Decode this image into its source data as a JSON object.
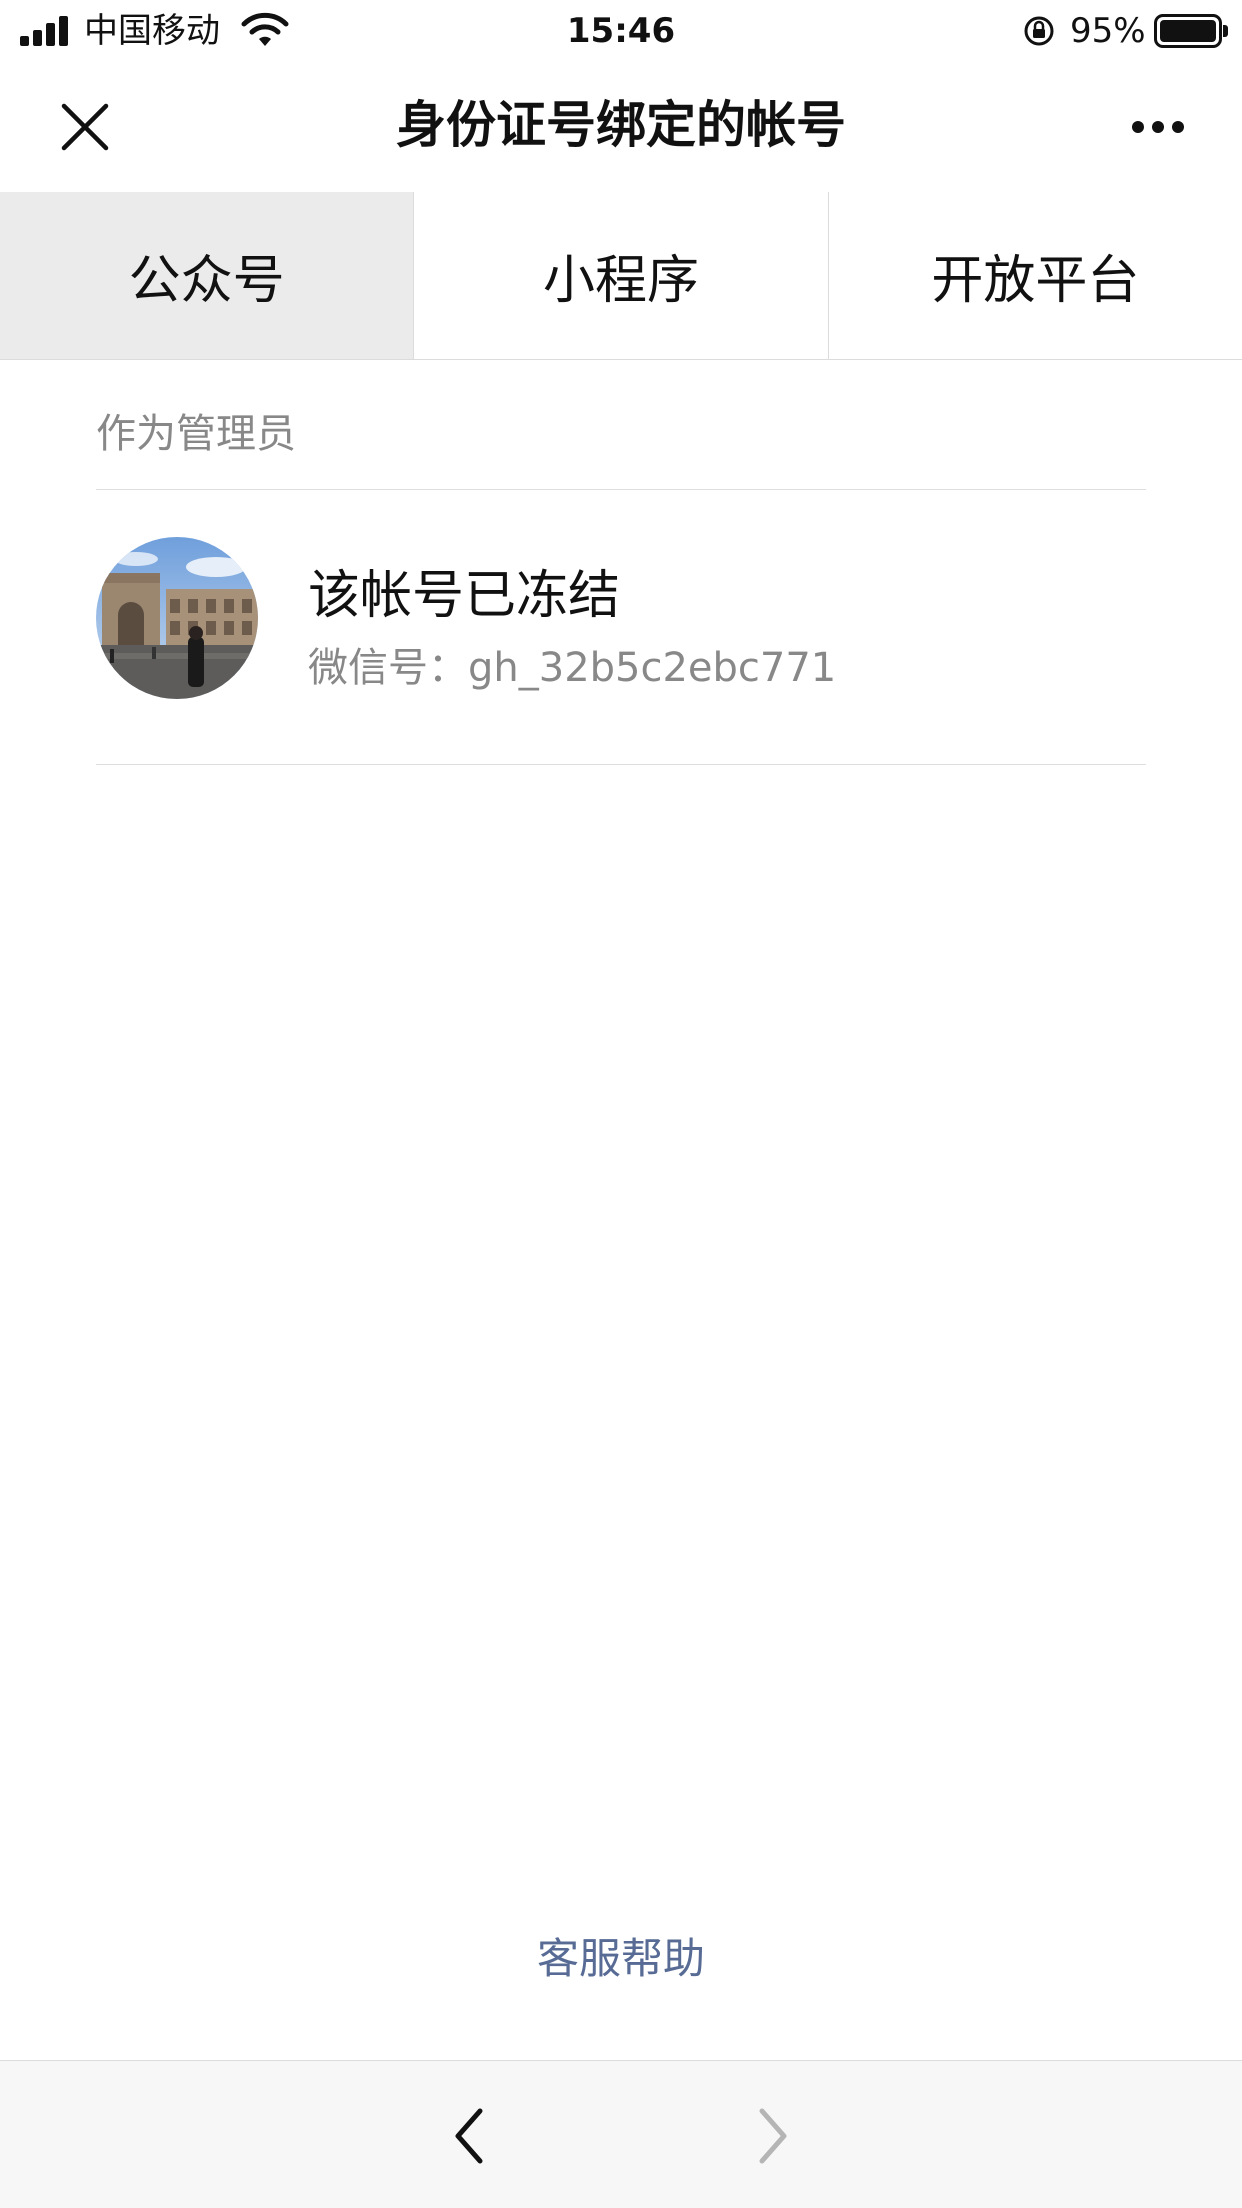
{
  "status_bar": {
    "carrier": "中国移动",
    "time": "15:46",
    "battery": "95%"
  },
  "nav": {
    "title": "身份证号绑定的帐号"
  },
  "tabs": [
    {
      "label": "公众号",
      "active": true
    },
    {
      "label": "小程序",
      "active": false
    },
    {
      "label": "开放平台",
      "active": false
    }
  ],
  "section": {
    "label": "作为管理员"
  },
  "account": {
    "name": "该帐号已冻结",
    "wechat_id": "微信号：gh_32b5c2ebc771"
  },
  "help": {
    "label": "客服帮助"
  },
  "colors": {
    "link": "#576b95",
    "secondary_text": "#888888",
    "active_tab_bg": "#ebebeb"
  },
  "icons": {
    "close": "close-icon",
    "more": "more-icon",
    "back": "chevron-left-icon",
    "forward": "chevron-right-icon"
  }
}
